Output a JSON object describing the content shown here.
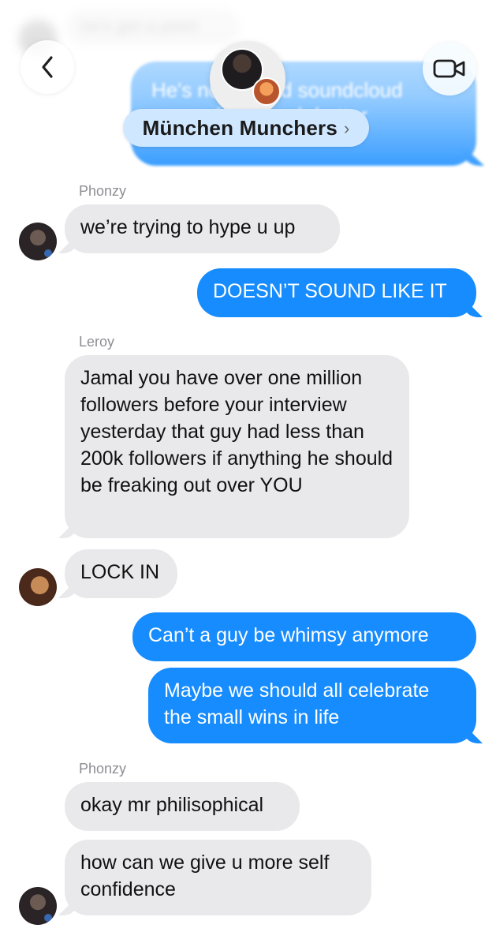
{
  "header": {
    "back_icon": "chevron-left-icon",
    "video_icon": "video-camera-icon",
    "group_name": "München Munchers",
    "chevron_icon": "chevron-right-icon",
    "group_photo_icon": "group-photo"
  },
  "top_blur": {
    "incoming_text": "he's got a point",
    "outgoing_text": "He's no verified soundcloud rapper he's much better"
  },
  "messages": [
    {
      "sender": "Phonzy",
      "text": "we’re trying to hype u up",
      "direction": "incoming"
    },
    {
      "text": "DOESN’T SOUND LIKE IT",
      "direction": "outgoing"
    },
    {
      "sender": "Leroy",
      "text": "Jamal you have over one million followers before your interview yesterday that guy had less than 200k followers if anything he should be freaking out over YOU",
      "direction": "incoming"
    },
    {
      "text": "LOCK IN",
      "direction": "incoming"
    },
    {
      "text": "Can’t a guy be whimsy anymore",
      "direction": "outgoing"
    },
    {
      "text": "Maybe we should all celebrate the small wins in life",
      "direction": "outgoing"
    },
    {
      "sender": "Phonzy",
      "text": "okay mr philisophical",
      "direction": "incoming"
    },
    {
      "text": "how can we give u more self confidence",
      "direction": "incoming"
    }
  ],
  "colors": {
    "outgoing_bubble": "#168cff",
    "incoming_bubble": "#e9e9eb",
    "sender_label": "#8e8e93"
  }
}
